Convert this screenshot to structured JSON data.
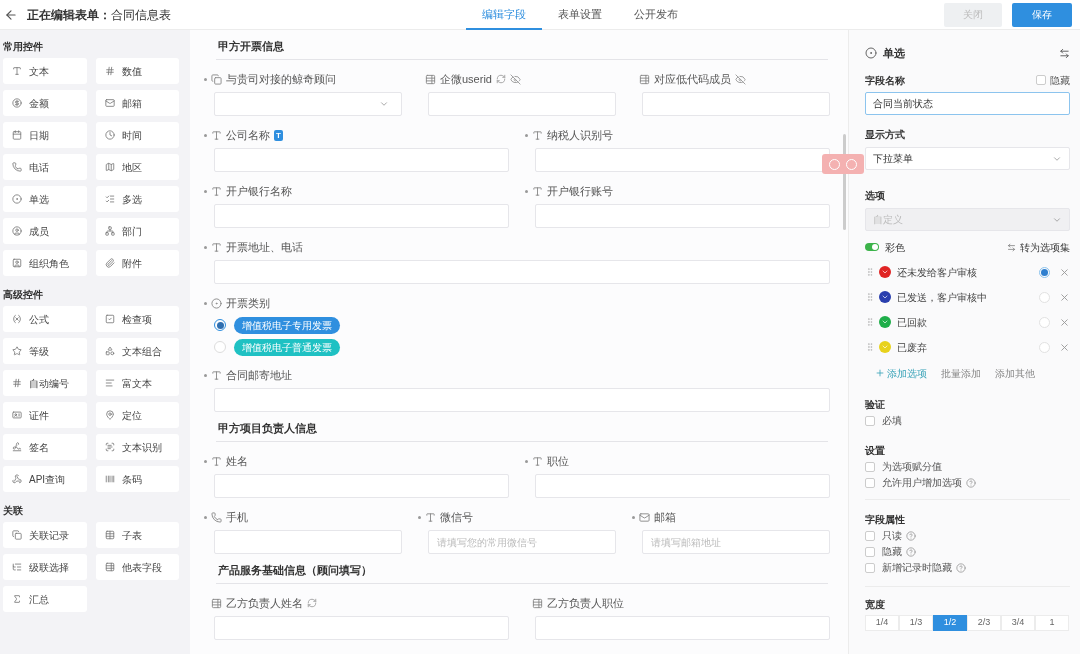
{
  "header": {
    "title_prefix": "正在编辑表单：",
    "title": "合同信息表",
    "tabs": [
      {
        "label": "编辑字段",
        "selected": true
      },
      {
        "label": "表单设置",
        "selected": false
      },
      {
        "label": "公开发布",
        "selected": false
      }
    ],
    "close_button": {
      "label": "关闭",
      "disabled": true
    },
    "save_button": {
      "label": "保存"
    }
  },
  "sidebar": [
    {
      "title": "常用控件",
      "items": [
        "文本",
        "数值",
        "金额",
        "邮箱",
        "日期",
        "时间",
        "电话",
        "地区",
        "单选",
        "多选",
        "成员",
        "部门",
        "组织角色",
        "附件"
      ]
    },
    {
      "title": "高级控件",
      "items": [
        "公式",
        "检查项",
        "等级",
        "文本组合",
        "自动编号",
        "富文本",
        "证件",
        "定位",
        "签名",
        "文本识别",
        "API查询",
        "条码"
      ]
    },
    {
      "title": "关联",
      "items": [
        "关联记录",
        "子表",
        "级联选择",
        "他表字段",
        "汇总"
      ]
    }
  ],
  "form": [
    {
      "title": "甲方开票信息",
      "rows": [
        [
          {
            "label": "与贵司对接的鲸奇顾问",
            "kind": "member",
            "required": true,
            "dropdown": true
          },
          {
            "label": "企微userid",
            "kind": "lookup",
            "required": false,
            "synced": true,
            "hidden": true
          },
          {
            "label": "对应低代码成员",
            "kind": "lookup",
            "required": false,
            "hidden": true
          }
        ],
        [
          {
            "label": "公司名称",
            "kind": "text",
            "required": true,
            "badge": "T"
          },
          {
            "label": "纳税人识别号",
            "kind": "text",
            "required": true
          }
        ],
        [
          {
            "label": "开户银行名称",
            "kind": "text",
            "required": true
          },
          {
            "label": "开户银行账号",
            "kind": "text",
            "required": true
          }
        ],
        [
          {
            "label": "开票地址、电话",
            "kind": "text",
            "required": true
          }
        ],
        [
          {
            "label": "开票类别",
            "kind": "radio",
            "required": true,
            "options": [
              {
                "label": "增值税电子专用发票",
                "selected": true,
                "color": "#2f8fdf"
              },
              {
                "label": "增值税电子普通发票",
                "selected": false,
                "color": "#1fc1c3"
              }
            ]
          }
        ],
        [
          {
            "label": "合同邮寄地址",
            "kind": "text",
            "required": true
          }
        ]
      ]
    },
    {
      "title": "甲方项目负责人信息",
      "rows": [
        [
          {
            "label": "姓名",
            "kind": "text",
            "required": true
          },
          {
            "label": "职位",
            "kind": "text",
            "required": true
          }
        ],
        [
          {
            "label": "手机",
            "kind": "phone",
            "required": true
          },
          {
            "label": "微信号",
            "kind": "text",
            "required": true,
            "placeholder": "请填写您的常用微信号"
          },
          {
            "label": "邮箱",
            "kind": "email",
            "required": true,
            "placeholder": "请填写邮箱地址"
          }
        ]
      ]
    },
    {
      "title": "产品服务基础信息（顾问填写）",
      "rows": [
        [
          {
            "label": "乙方负责人姓名",
            "kind": "lookup",
            "required": false,
            "synced": true
          },
          {
            "label": "乙方负责人职位",
            "kind": "lookup",
            "required": false
          }
        ]
      ]
    }
  ],
  "panel": {
    "title": "单选",
    "field_name_label": "字段名称",
    "hide": {
      "label": "隐藏",
      "checked": false
    },
    "field_name": "合同当前状态",
    "display_label": "显示方式",
    "display_value": "下拉菜单",
    "options_label": "选项",
    "options_source": {
      "value": "自定义",
      "disabled": true
    },
    "colorful": {
      "label": "彩色",
      "on": true
    },
    "convert_link": "转为选项集",
    "options": [
      {
        "label": "还未发给客户审核",
        "color": "#e02424",
        "selected": true
      },
      {
        "label": "已发送，客户审核中",
        "color": "#2a3fae",
        "selected": false
      },
      {
        "label": "已回款",
        "color": "#1fae4a",
        "selected": false
      },
      {
        "label": "已废弃",
        "color": "#e8d21c",
        "selected": false
      }
    ],
    "add_links": [
      "添加选项",
      "批量添加",
      "添加其他"
    ],
    "groups": [
      {
        "title": "验证",
        "items": [
          {
            "label": "必填",
            "checked": false,
            "help": false
          }
        ]
      },
      {
        "title": "设置",
        "items": [
          {
            "label": "为选项赋分值",
            "checked": false,
            "help": false
          },
          {
            "label": "允许用户增加选项",
            "checked": false,
            "help": true
          }
        ]
      },
      {
        "title": "字段属性",
        "items": [
          {
            "label": "只读",
            "checked": false,
            "help": true
          },
          {
            "label": "隐藏",
            "checked": false,
            "help": true
          },
          {
            "label": "新增记录时隐藏",
            "checked": false,
            "help": true
          }
        ]
      }
    ],
    "width": {
      "label": "宽度",
      "options": [
        {
          "label": "1/4",
          "selected": false
        },
        {
          "label": "1/3",
          "selected": false
        },
        {
          "label": "1/2",
          "selected": true
        },
        {
          "label": "2/3",
          "selected": false
        },
        {
          "label": "3/4",
          "selected": false
        },
        {
          "label": "1",
          "selected": false
        }
      ]
    }
  }
}
